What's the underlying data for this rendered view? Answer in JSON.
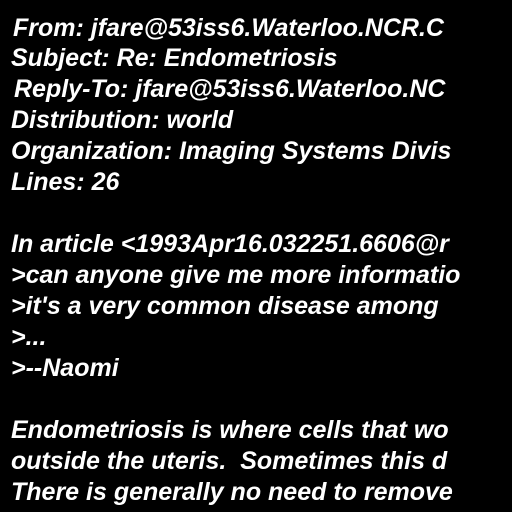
{
  "colors": {
    "background": "#000000",
    "text": "#ffffff"
  },
  "header": {
    "from": "From: jfare@53iss6.Waterloo.NCR.C",
    "subject": "Subject: Re: Endometriosis",
    "reply_to": "Reply-To: jfare@53iss6.Waterloo.NC",
    "distribution": "Distribution: world",
    "organization": "Organization: Imaging Systems Divis",
    "lines": "Lines: 26"
  },
  "body": {
    "attribution": "In article <1993Apr16.032251.6606@r",
    "quote_1": ">can anyone give me more informatio",
    "quote_2": ">it's a very common disease among",
    "quote_3": ">...",
    "quote_4": ">--Naomi",
    "para_1": "Endometriosis is where cells that wo",
    "para_2": "outside the uteris.  Sometimes this d",
    "para_3": "There is generally no need to remove"
  }
}
